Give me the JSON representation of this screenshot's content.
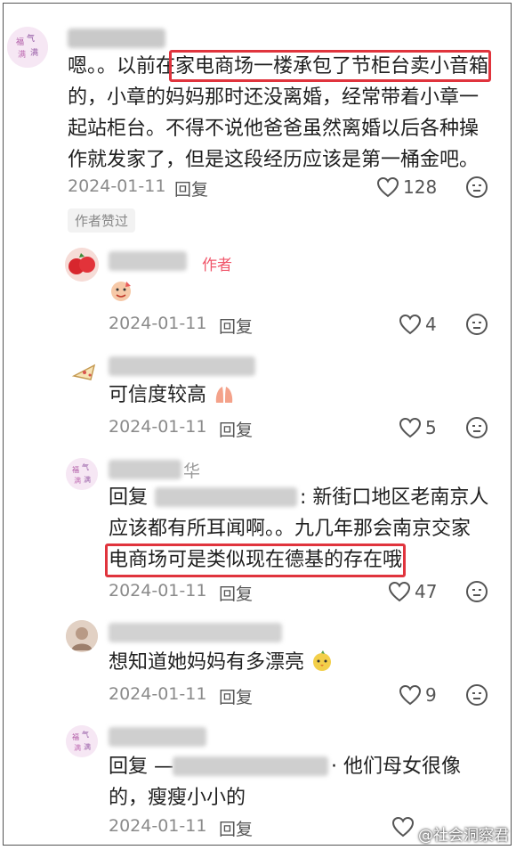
{
  "comments": [
    {
      "text": "嗯。。以前在家电商场一楼承包了节柜台卖小音箱的，小章的妈妈那时还没离婚，经常带着小章一起站柜台。不得不说他爸爸虽然离婚以后各种操作就发家了，但是这段经历应该是第一桶金吧。",
      "lines": [
        "嗯。。以前在家电商场一楼承包了节柜台卖小音箱",
        "的，小章的妈妈那时还没离婚，经常带着小章一",
        "起站柜台。不得不说他爸爸虽然离婚以后各种操",
        "作就发家了，但是这段经历应该是第一桶金吧。"
      ],
      "date": "2024-01-11",
      "reply_label": "回复",
      "likes": "128",
      "liked_by_author": "作者赞过"
    },
    {
      "author_tag": "作者",
      "date": "2024-01-11",
      "reply_label": "回复",
      "likes": "4"
    },
    {
      "text": "可信度较高",
      "date": "2024-01-11",
      "reply_label": "回复",
      "likes": "5"
    },
    {
      "lines": [
        "回复",
        ": 新街口地区老南京人",
        "应该都有所耳闻啊。。九几年那会南京交家",
        "电商场可是类似现在德基的存在哦"
      ],
      "name_tail": "华",
      "date": "2024-01-11",
      "reply_label": "回复",
      "likes": "47"
    },
    {
      "text": "想知道她妈妈有多漂亮",
      "date": "2024-01-11",
      "reply_label": "回复",
      "likes": "9"
    },
    {
      "lines": [
        "回复 —",
        "· 他们母女很像",
        "的，瘦瘦小小的"
      ],
      "date": "2024-01-11",
      "reply_label": "回复",
      "likes": ""
    }
  ],
  "watermark": "@社会洞察君",
  "colors": {
    "highlight": "#e0343d",
    "author_tag": "#f0566a",
    "meta": "#8a8a8a"
  },
  "icons": [
    "heart-icon",
    "dislike-face-icon",
    "sticker-emoji",
    "hands-emoji",
    "chick-emoji"
  ]
}
